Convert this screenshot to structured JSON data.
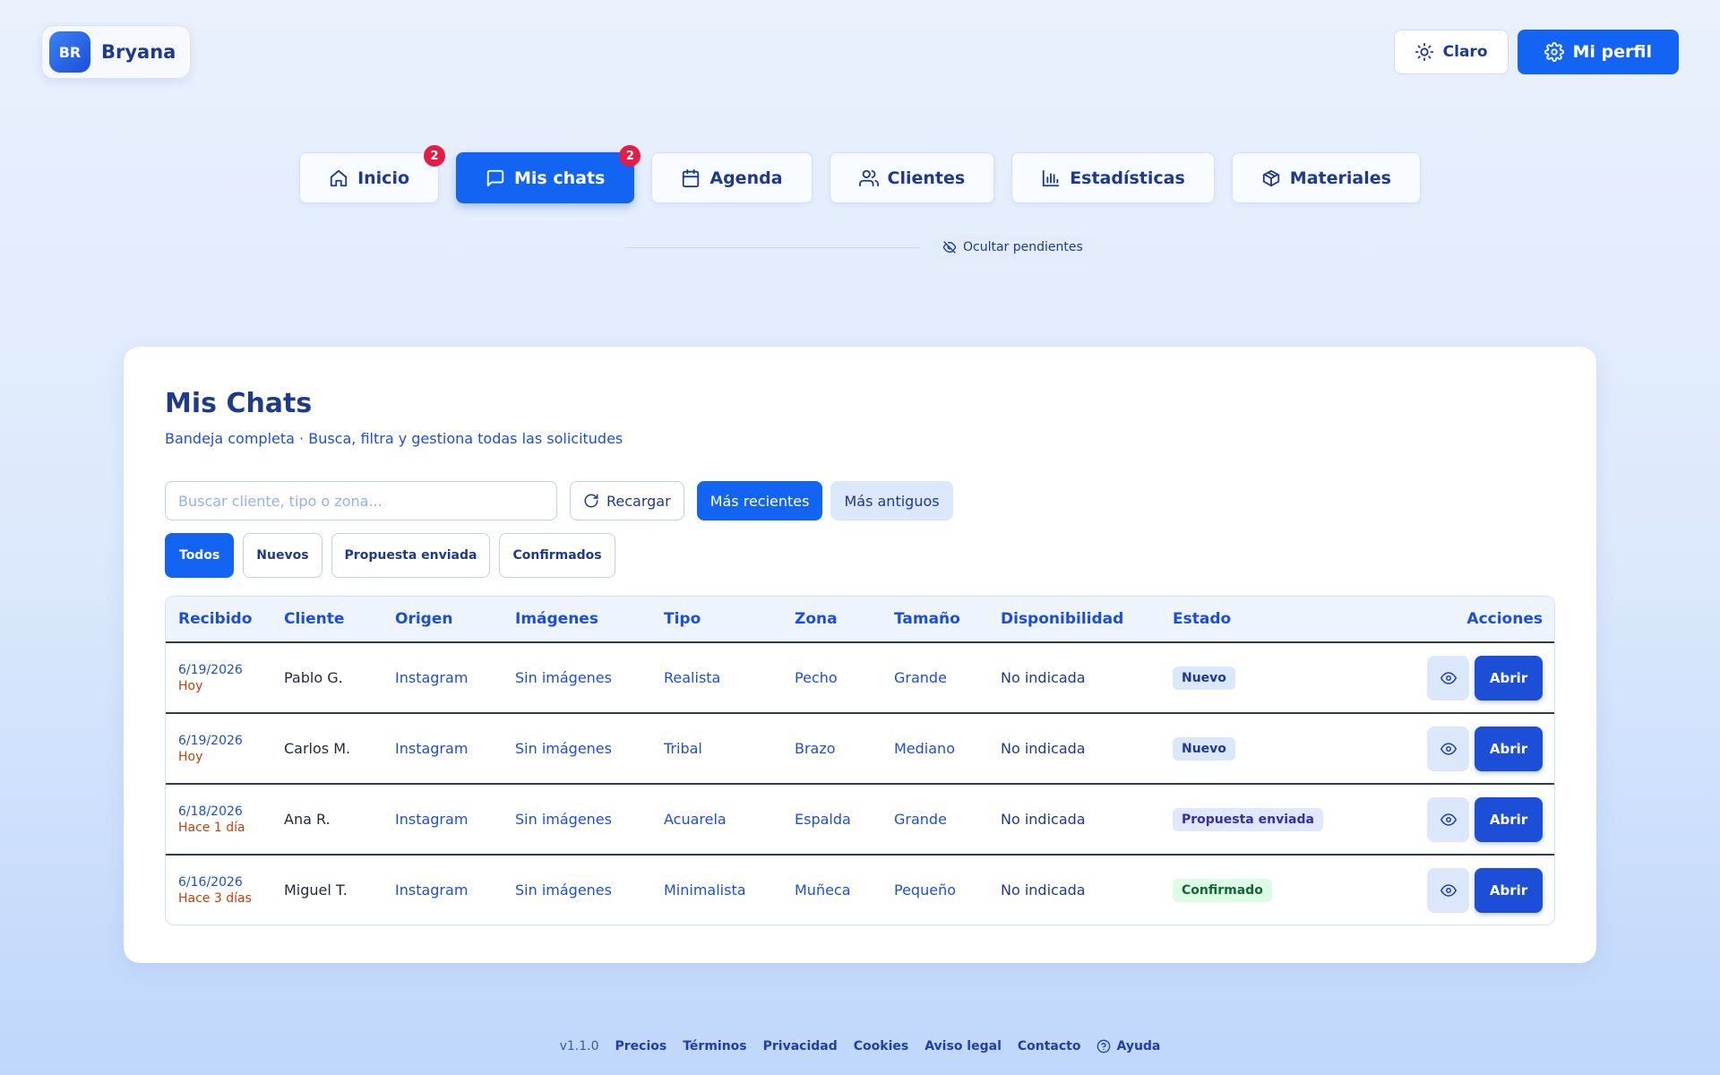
{
  "user": {
    "initials": "BR",
    "name": "Bryana"
  },
  "header": {
    "theme_label": "Claro",
    "profile_label": "Mi perfil"
  },
  "nav": [
    {
      "label": "Inicio",
      "badge": "2",
      "icon": "home-icon"
    },
    {
      "label": "Mis chats",
      "badge": "2",
      "icon": "chat-icon",
      "active": true
    },
    {
      "label": "Agenda",
      "icon": "calendar-icon"
    },
    {
      "label": "Clientes",
      "icon": "users-icon"
    },
    {
      "label": "Estadísticas",
      "icon": "bar-chart-icon"
    },
    {
      "label": "Materiales",
      "icon": "box-icon"
    }
  ],
  "pending_toggle": "Ocultar pendientes",
  "main": {
    "title": "Mis Chats",
    "subtitle": "Bandeja completa · Busca, filtra y gestiona todas las solicitudes",
    "search_placeholder": "Buscar cliente, tipo o zona...",
    "reload_label": "Recargar",
    "sort_newest": "Más recientes",
    "sort_oldest": "Más antiguos",
    "filters": [
      "Todos",
      "Nuevos",
      "Propuesta enviada",
      "Confirmados"
    ],
    "columns": [
      "Recibido",
      "Cliente",
      "Origen",
      "Imágenes",
      "Tipo",
      "Zona",
      "Tamaño",
      "Disponibilidad",
      "Estado",
      "Acciones"
    ],
    "rows": [
      {
        "date": "6/19/2026",
        "rel": "Hoy",
        "client": "Pablo G.",
        "origin": "Instagram",
        "images": "Sin imágenes",
        "type": "Realista",
        "zone": "Pecho",
        "size": "Grande",
        "availability": "No indicada",
        "status": "Nuevo"
      },
      {
        "date": "6/19/2026",
        "rel": "Hoy",
        "client": "Carlos M.",
        "origin": "Instagram",
        "images": "Sin imágenes",
        "type": "Tribal",
        "zone": "Brazo",
        "size": "Mediano",
        "availability": "No indicada",
        "status": "Nuevo"
      },
      {
        "date": "6/18/2026",
        "rel": "Hace 1 día",
        "client": "Ana R.",
        "origin": "Instagram",
        "images": "Sin imágenes",
        "type": "Acuarela",
        "zone": "Espalda",
        "size": "Grande",
        "availability": "No indicada",
        "status": "Propuesta enviada"
      },
      {
        "date": "6/16/2026",
        "rel": "Hace 3 días",
        "client": "Miguel T.",
        "origin": "Instagram",
        "images": "Sin imágenes",
        "type": "Minimalista",
        "zone": "Muñeca",
        "size": "Pequeño",
        "availability": "No indicada",
        "status": "Confirmado"
      }
    ],
    "open_label": "Abrir"
  },
  "footer": {
    "version": "v1.1.0",
    "links": [
      "Precios",
      "Términos",
      "Privacidad",
      "Cookies",
      "Aviso legal",
      "Contacto",
      "Ayuda"
    ]
  },
  "colors": {
    "primary": "#1464f4",
    "badge": "#e11d48",
    "accent_text": "#1d4ed8"
  }
}
